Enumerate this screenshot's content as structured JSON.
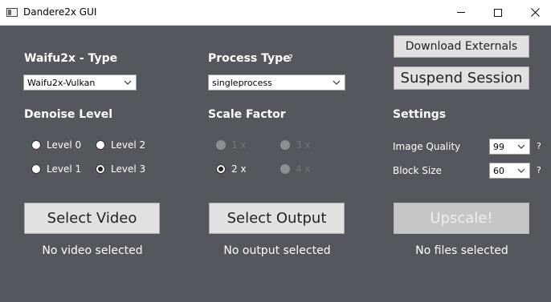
{
  "window": {
    "title": "Dandere2x GUI"
  },
  "waifu2x": {
    "label": "Waifu2x - Type",
    "selected": "Waifu2x-Vulkan"
  },
  "process": {
    "label": "Process Type",
    "help": "?",
    "selected": "singleprocess"
  },
  "denoise": {
    "label": "Denoise Level",
    "options": [
      {
        "label": "Level 0",
        "checked": false
      },
      {
        "label": "Level 2",
        "checked": false
      },
      {
        "label": "Level 1",
        "checked": false
      },
      {
        "label": "Level 3",
        "checked": true
      }
    ]
  },
  "scale": {
    "label": "Scale Factor",
    "options": [
      {
        "label": "1 x",
        "checked": false,
        "enabled": false
      },
      {
        "label": "3 x",
        "checked": false,
        "enabled": false
      },
      {
        "label": "2 x",
        "checked": true,
        "enabled": true
      },
      {
        "label": "4 x",
        "checked": false,
        "enabled": false
      }
    ]
  },
  "settings": {
    "label": "Settings",
    "image_quality": {
      "label": "Image Quality",
      "value": "99",
      "help": "?"
    },
    "block_size": {
      "label": "Block Size",
      "value": "60",
      "help": "?"
    }
  },
  "actions": {
    "download": "Download Externals",
    "suspend": "Suspend Session",
    "select_video": "Select Video",
    "select_output": "Select Output",
    "upscale": "Upscale!"
  },
  "status": {
    "video": "No video selected",
    "output": "No output selected",
    "files": "No files selected"
  }
}
